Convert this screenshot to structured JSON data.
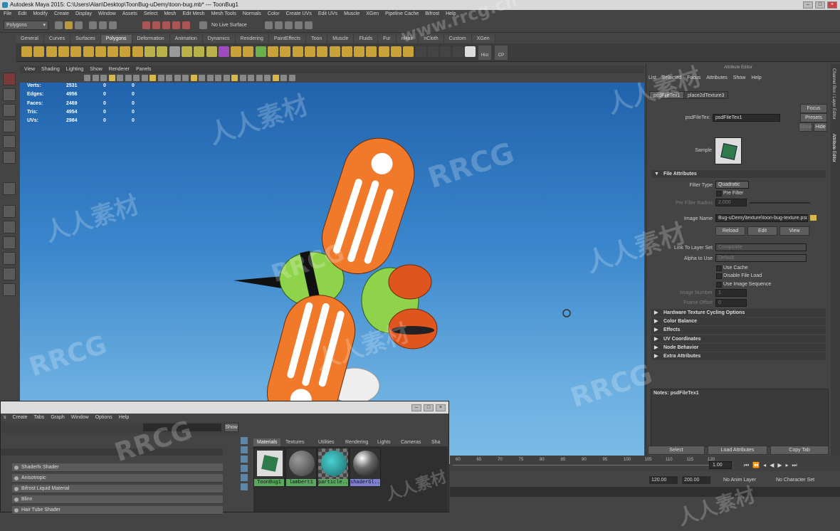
{
  "window": {
    "title": "Autodesk Maya 2015: C:\\Users\\Alan\\Desktop\\ToonBug-uDemy\\toon-bug.mb*   ---   ToonBug1"
  },
  "menu": [
    "File",
    "Edit",
    "Modify",
    "Create",
    "Display",
    "Window",
    "Assets",
    "Select",
    "Mesh",
    "Edit Mesh",
    "Mesh Tools",
    "Normals",
    "Color",
    "Create UVs",
    "Edit UVs",
    "Muscle",
    "XGen",
    "Pipeline Cache",
    "Bifrost",
    "Help"
  ],
  "status": {
    "mode": "Polygons",
    "live_surface": "No Live Surface"
  },
  "shelf": {
    "tabs": [
      "General",
      "Curves",
      "Surfaces",
      "Polygons",
      "Deformation",
      "Animation",
      "Dynamics",
      "Rendering",
      "PaintEffects",
      "Toon",
      "Muscle",
      "Fluids",
      "Fur",
      "nHair",
      "nCloth",
      "Custom",
      "XGen"
    ],
    "active_tab": "Polygons",
    "extra_labels": [
      "Hist",
      "CP"
    ]
  },
  "viewport": {
    "menu": [
      "View",
      "Shading",
      "Lighting",
      "Show",
      "Renderer",
      "Panels"
    ],
    "hud": [
      {
        "label": "Verts:",
        "a": "2531",
        "b": "0",
        "c": "0"
      },
      {
        "label": "Edges:",
        "a": "4956",
        "b": "0",
        "c": "0"
      },
      {
        "label": "Faces:",
        "a": "2469",
        "b": "0",
        "c": "0"
      },
      {
        "label": "Tris:",
        "a": "4954",
        "b": "0",
        "c": "0"
      },
      {
        "label": "UVs:",
        "a": "2984",
        "b": "0",
        "c": "0"
      }
    ]
  },
  "attribute_editor": {
    "header": "Attribute Editor",
    "menu": [
      "List",
      "Selected",
      "Focus",
      "Attributes",
      "Show",
      "Help"
    ],
    "tabs": [
      "psdFileTex1",
      "place2dTexture3"
    ],
    "node_label": "psdFileTex:",
    "node_value": "psdFileTex1",
    "focus_btn": "Focus",
    "presets_btn": "Presets",
    "show_btn": "Show",
    "hide_btn": "Hide",
    "sample_label": "Sample",
    "file_attributes": "File Attributes",
    "filter_type_label": "Filter Type",
    "filter_type_value": "Quadratic",
    "pre_filter": "Pre Filter",
    "pre_filter_radius_label": "Pre Filter Radius",
    "pre_filter_radius_value": "2.000",
    "image_name_label": "Image Name",
    "image_name_value": "Bug-uDemy\\texture\\toon-bug-texture.psd",
    "reload": "Reload",
    "edit": "Edit",
    "view": "View",
    "link_layer_label": "Link To Layer Set",
    "link_layer_value": "Composite",
    "alpha_label": "Alpha to Use",
    "alpha_value": "Default",
    "use_cache": "Use Cache",
    "disable_file_load": "Disable File Load",
    "use_image_sequence": "Use Image Sequence",
    "image_number_label": "Image Number",
    "image_number_value": "1",
    "frame_offset_label": "Frame Offset",
    "frame_offset_value": "0",
    "sections": [
      "Hardware Texture Cycling Options",
      "Color Balance",
      "Effects",
      "UV Coordinates",
      "Node Behavior",
      "Extra Attributes"
    ],
    "notes": "Notes: psdFileTex1",
    "bottom_buttons": [
      "Select",
      "Load Attributes",
      "Copy Tab"
    ]
  },
  "side_tabs": [
    "Channel Box / Layer Editor",
    "Attribute Editor"
  ],
  "timeline": {
    "ticks": [
      "60",
      "65",
      "70",
      "75",
      "80",
      "85",
      "90",
      "95",
      "100",
      "105",
      "110",
      "115",
      "120"
    ],
    "current": "1.00",
    "range_end": "120.00",
    "range_max": "200.00",
    "anim_layer": "No Anim Layer",
    "char_set": "No Character Set"
  },
  "hypershade": {
    "menu": [
      "s",
      "Create",
      "Tabs",
      "Graph",
      "Window",
      "Options",
      "Help"
    ],
    "show_btn": "Show",
    "tabs": [
      "Materials",
      "Textures",
      "Utilities",
      "Rendering",
      "Lights",
      "Cameras",
      "Sha"
    ],
    "active_tab": "Materials",
    "materials": [
      "ToonBug1",
      "lambert1",
      "particle...",
      "shaderGl..."
    ],
    "create_list": [
      "Shaderfx Shader",
      "Anisotropic",
      "Bifrost Liquid Material",
      "Blinn",
      "Hair Tube Shader"
    ]
  },
  "watermarks": [
    "www.rrcg.cn",
    "人人素材",
    "RRCG"
  ],
  "colors": {
    "accent": "#5d5d5d",
    "viewport_top": "#1e5fa8",
    "viewport_bottom": "#7cbbe6",
    "wing_orange": "#f07a2a",
    "bug_green": "#8fd34a"
  }
}
